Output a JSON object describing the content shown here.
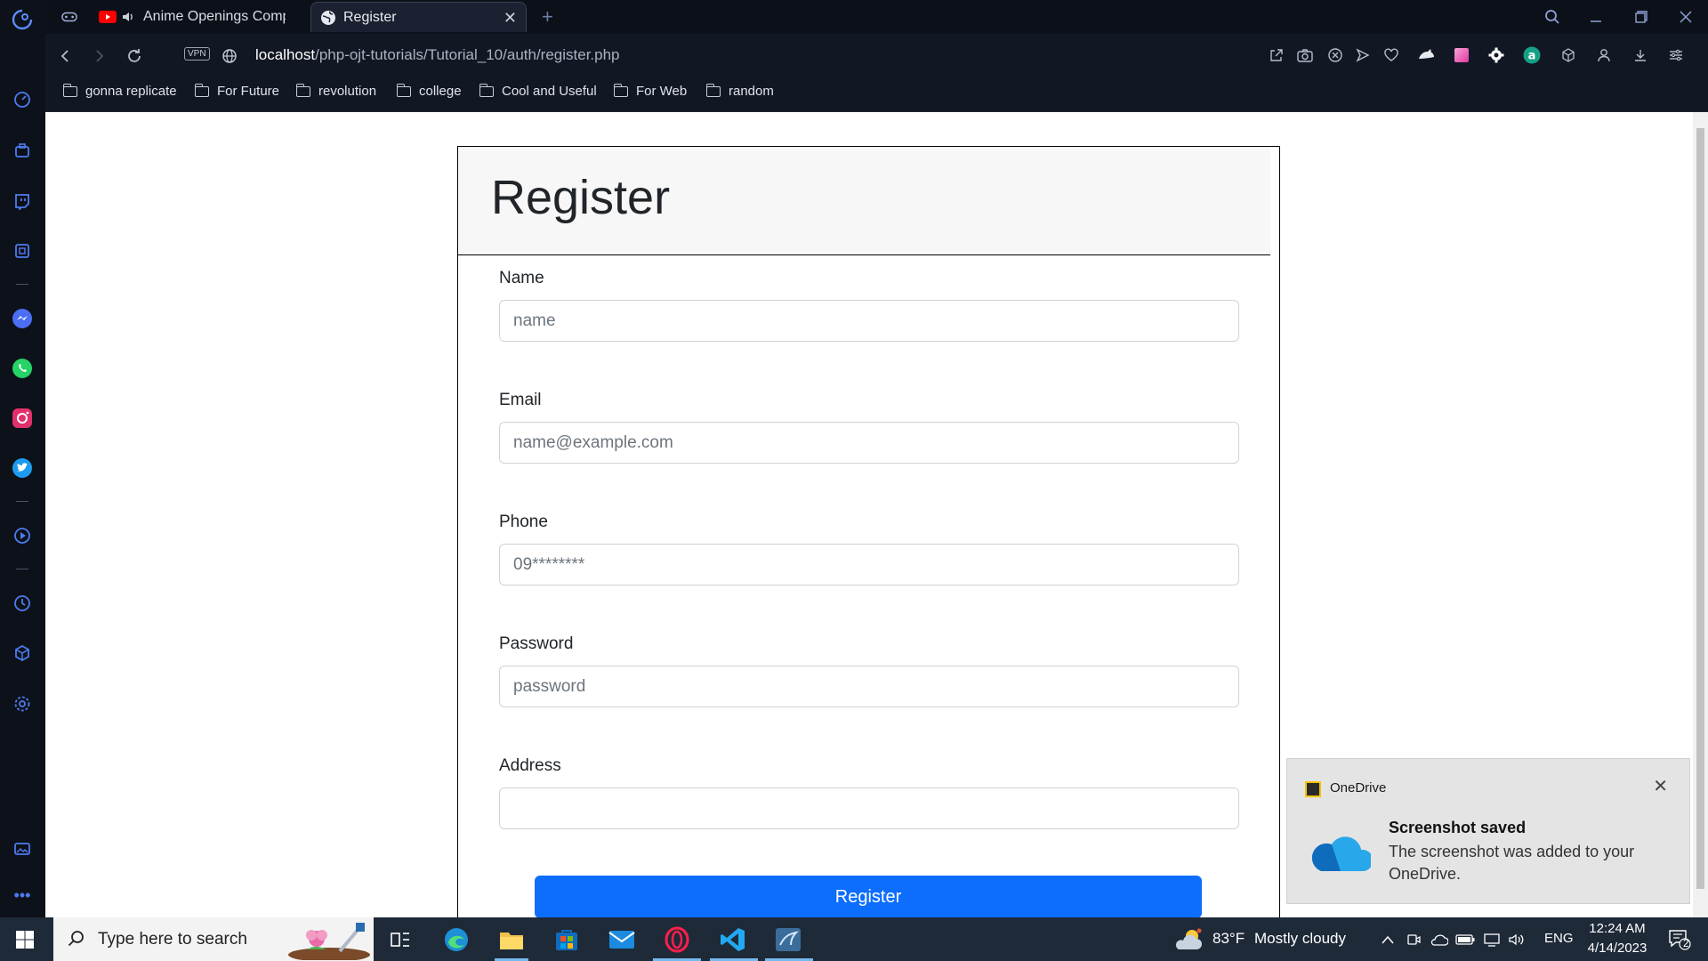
{
  "tabs": [
    {
      "title": "Anime Openings Comp"
    },
    {
      "title": "Register"
    }
  ],
  "address": {
    "vpn_label": "VPN",
    "url_host": "localhost",
    "url_path": "/php-ojt-tutorials/Tutorial_10/auth/register.php"
  },
  "bookmarks": [
    {
      "label": "gonna replicate"
    },
    {
      "label": "For Future"
    },
    {
      "label": "revolution"
    },
    {
      "label": "college"
    },
    {
      "label": "Cool and Useful"
    },
    {
      "label": "For Web"
    },
    {
      "label": "random"
    }
  ],
  "form": {
    "title": "Register",
    "fields": [
      {
        "label": "Name",
        "placeholder": "name",
        "value": ""
      },
      {
        "label": "Email",
        "placeholder": "name@example.com",
        "value": ""
      },
      {
        "label": "Phone",
        "placeholder": "09********",
        "value": ""
      },
      {
        "label": "Password",
        "placeholder": "password",
        "value": ""
      },
      {
        "label": "Address",
        "placeholder": "",
        "value": ""
      }
    ],
    "submit_label": "Register"
  },
  "toast": {
    "app_name": "OneDrive",
    "heading": "Screenshot saved",
    "body": "The screenshot was added to your OneDrive."
  },
  "taskbar": {
    "search_placeholder": "Type here to search",
    "weather_temp": "83°F",
    "weather_desc": "Mostly cloudy",
    "language": "ENG",
    "time": "12:24 AM",
    "date": "4/14/2023",
    "notification_count": "2"
  },
  "colors": {
    "primary_button": "#0d6efd",
    "browser_bg": "#0c1018",
    "taskbar_bg": "#1f2a38"
  }
}
